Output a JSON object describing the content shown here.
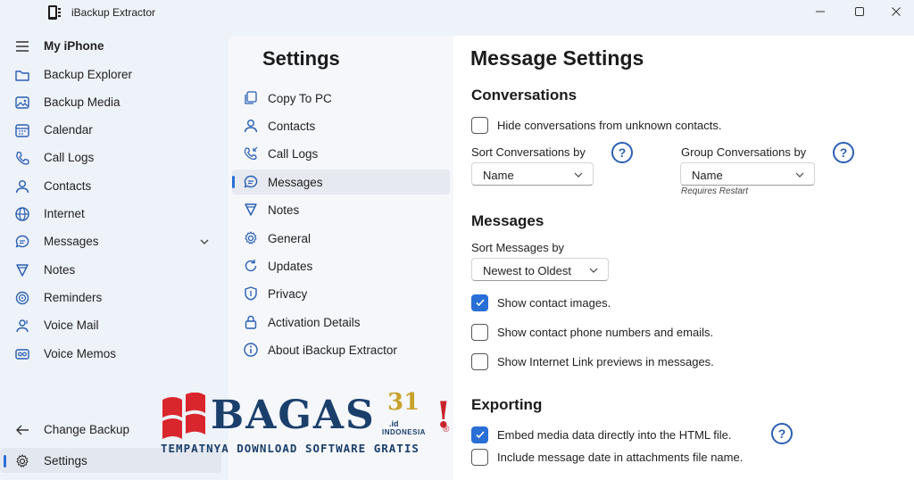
{
  "window": {
    "title": "iBackup Extractor"
  },
  "nav": {
    "device": "My iPhone",
    "items": [
      {
        "label": "Backup Explorer",
        "icon": "folder-icon"
      },
      {
        "label": "Backup Media",
        "icon": "image-icon"
      },
      {
        "label": "Calendar",
        "icon": "calendar-icon"
      },
      {
        "label": "Call Logs",
        "icon": "phone-icon"
      },
      {
        "label": "Contacts",
        "icon": "person-icon"
      },
      {
        "label": "Internet",
        "icon": "globe-icon"
      },
      {
        "label": "Messages",
        "icon": "chat-icon"
      },
      {
        "label": "Notes",
        "icon": "notes-icon"
      },
      {
        "label": "Reminders",
        "icon": "reminders-icon"
      },
      {
        "label": "Voice Mail",
        "icon": "voicemail-icon"
      },
      {
        "label": "Voice Memos",
        "icon": "voice-memo-icon"
      }
    ],
    "change_backup": "Change Backup",
    "settings": "Settings"
  },
  "settings_panel": {
    "title": "Settings",
    "items": [
      {
        "label": "Copy To PC"
      },
      {
        "label": "Contacts"
      },
      {
        "label": "Call Logs"
      },
      {
        "label": "Messages"
      },
      {
        "label": "Notes"
      },
      {
        "label": "General"
      },
      {
        "label": "Updates"
      },
      {
        "label": "Privacy"
      },
      {
        "label": "Activation Details"
      },
      {
        "label": "About iBackup Extractor"
      }
    ],
    "active": "Messages"
  },
  "content": {
    "title": "Message Settings",
    "conversations": {
      "heading": "Conversations",
      "hide_unknown": {
        "label": "Hide conversations from unknown contacts.",
        "checked": false
      },
      "sort_label": "Sort Conversations by",
      "sort_value": "Name",
      "group_label": "Group Conversations by",
      "group_value": "Name",
      "requires_restart": "Requires Restart"
    },
    "messages": {
      "heading": "Messages",
      "sort_label": "Sort Messages by",
      "sort_value": "Newest to Oldest",
      "show_images": {
        "label": "Show contact images.",
        "checked": true
      },
      "show_numbers": {
        "label": "Show contact phone numbers and emails.",
        "checked": false
      },
      "show_previews": {
        "label": "Show Internet Link previews in messages.",
        "checked": false
      }
    },
    "exporting": {
      "heading": "Exporting",
      "embed_media": {
        "label": "Embed media data directly into the HTML file.",
        "checked": true
      },
      "include_date": {
        "label": "Include message date in attachments file name.",
        "checked": false
      }
    },
    "help_glyph": "?"
  },
  "watermark": {
    "brand": "BAGAS",
    "number": "31",
    "suffix": ".id",
    "country": "INDONESIA",
    "exclaim": "!",
    "reg": "®",
    "tagline": "TEMPATNYA DOWNLOAD SOFTWARE GRATIS"
  },
  "colors": {
    "accent": "#2a6fd6",
    "help": "#2a5fb3",
    "nav_bg": "#eef2f9",
    "content_bg": "#ffffff"
  }
}
